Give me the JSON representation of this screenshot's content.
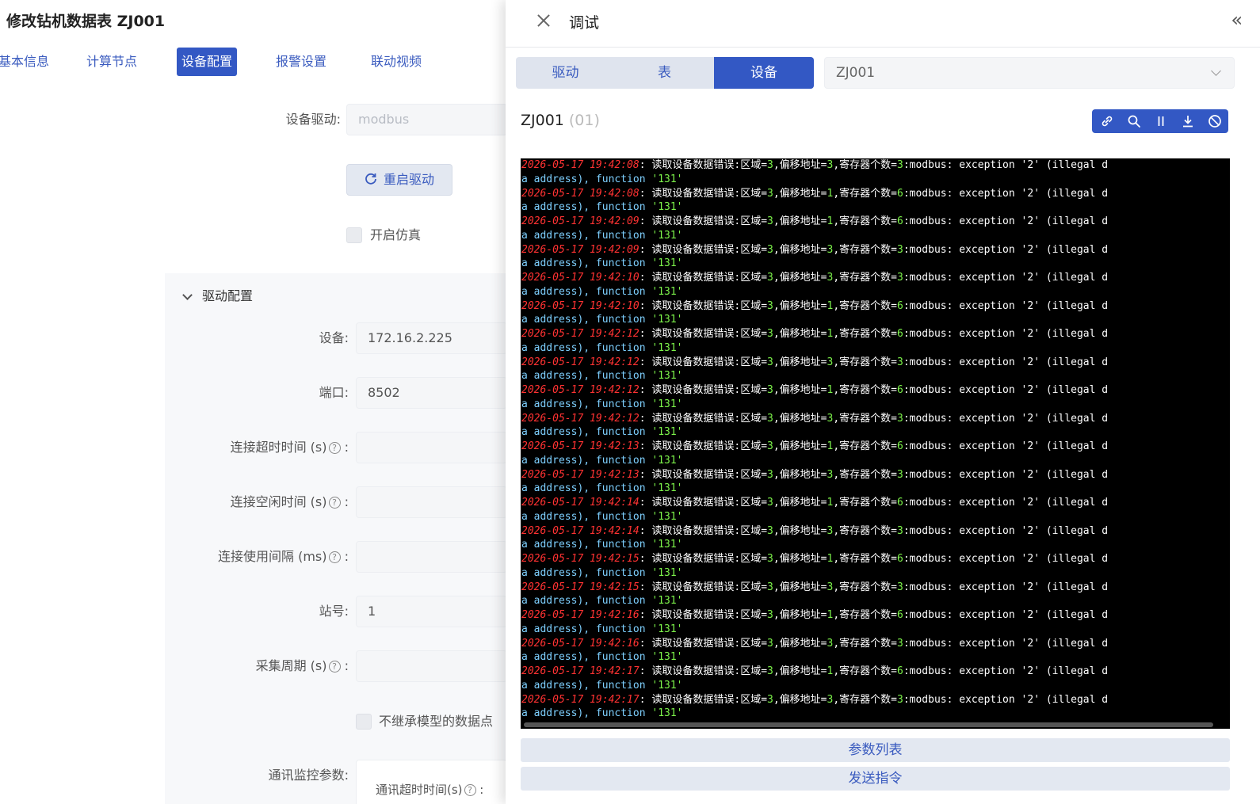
{
  "page_title": "修改钻机数据表 ZJ001",
  "tabs": [
    {
      "label": "基本信息"
    },
    {
      "label": "计算节点"
    },
    {
      "label": "设备配置"
    },
    {
      "label": "报警设置"
    },
    {
      "label": "联动视频"
    }
  ],
  "form": {
    "driver_label": "设备驱动:",
    "driver_value": "modbus",
    "restart_label": "重启驱动",
    "simulate_label": "开启仿真",
    "section_title": "驱动配置",
    "fields": [
      {
        "label": "设备:",
        "value": "172.16.2.225",
        "help": false
      },
      {
        "label": "端口:",
        "value": "8502",
        "help": false
      },
      {
        "label": "连接超时时间 (s)",
        "value": "",
        "help": true
      },
      {
        "label": "连接空闲时间 (s)",
        "value": "",
        "help": true
      },
      {
        "label": "连接使用间隔 (ms)",
        "value": "",
        "help": true
      },
      {
        "label": "站号:",
        "value": "1",
        "help": false
      },
      {
        "label": "采集周期 (s)",
        "value": "",
        "help": true
      }
    ],
    "no_inherit_label": "不继承模型的数据点",
    "monitor_label": "通讯监控参数:",
    "monitor_sub_label": "通讯超时时间(s)"
  },
  "drawer": {
    "title": "调试",
    "segments": [
      {
        "label": "驱动"
      },
      {
        "label": "表"
      },
      {
        "label": "设备"
      }
    ],
    "active_segment": 2,
    "selected_device": "ZJ001",
    "device_name": "ZJ001",
    "device_code": "(01)",
    "toolbar_icons": [
      "link-icon",
      "search-icon",
      "pause-icon",
      "download-icon",
      "clear-icon"
    ],
    "log": [
      {
        "ts": "2026-05-17 19:42:08",
        "area": "3",
        "offset": "3",
        "count": "3"
      },
      {
        "ts": "2026-05-17 19:42:08",
        "area": "3",
        "offset": "1",
        "count": "6"
      },
      {
        "ts": "2026-05-17 19:42:09",
        "area": "3",
        "offset": "1",
        "count": "6"
      },
      {
        "ts": "2026-05-17 19:42:09",
        "area": "3",
        "offset": "3",
        "count": "3"
      },
      {
        "ts": "2026-05-17 19:42:10",
        "area": "3",
        "offset": "3",
        "count": "3"
      },
      {
        "ts": "2026-05-17 19:42:10",
        "area": "3",
        "offset": "1",
        "count": "6"
      },
      {
        "ts": "2026-05-17 19:42:12",
        "area": "3",
        "offset": "1",
        "count": "6"
      },
      {
        "ts": "2026-05-17 19:42:12",
        "area": "3",
        "offset": "3",
        "count": "3"
      },
      {
        "ts": "2026-05-17 19:42:12",
        "area": "3",
        "offset": "1",
        "count": "6"
      },
      {
        "ts": "2026-05-17 19:42:12",
        "area": "3",
        "offset": "3",
        "count": "3"
      },
      {
        "ts": "2026-05-17 19:42:13",
        "area": "3",
        "offset": "1",
        "count": "6"
      },
      {
        "ts": "2026-05-17 19:42:13",
        "area": "3",
        "offset": "3",
        "count": "3"
      },
      {
        "ts": "2026-05-17 19:42:14",
        "area": "3",
        "offset": "1",
        "count": "6"
      },
      {
        "ts": "2026-05-17 19:42:14",
        "area": "3",
        "offset": "3",
        "count": "3"
      },
      {
        "ts": "2026-05-17 19:42:15",
        "area": "3",
        "offset": "1",
        "count": "6"
      },
      {
        "ts": "2026-05-17 19:42:15",
        "area": "3",
        "offset": "3",
        "count": "3"
      },
      {
        "ts": "2026-05-17 19:42:16",
        "area": "3",
        "offset": "1",
        "count": "6"
      },
      {
        "ts": "2026-05-17 19:42:16",
        "area": "3",
        "offset": "3",
        "count": "3"
      },
      {
        "ts": "2026-05-17 19:42:17",
        "area": "3",
        "offset": "1",
        "count": "6"
      },
      {
        "ts": "2026-05-17 19:42:17",
        "area": "3",
        "offset": "3",
        "count": "3"
      }
    ],
    "log_text": {
      "msg": "读取设备数据错误:区域=",
      "offset_label": ",偏移地址=",
      "count_label": ",寄存器个数=",
      "tail": ":modbus: exception '2' (illegal d",
      "wrap_a": "a address), ",
      "wrap_fn": "function",
      "wrap_code": " '131'"
    },
    "param_list_label": "参数列表",
    "send_command_label": "发送指令"
  },
  "colors": {
    "accent": "#3358c4",
    "light_accent": "#e3e8f1",
    "log_timestamp": "#ff3232",
    "log_number": "#7cf24a",
    "log_keyword": "#7ed0ff"
  }
}
